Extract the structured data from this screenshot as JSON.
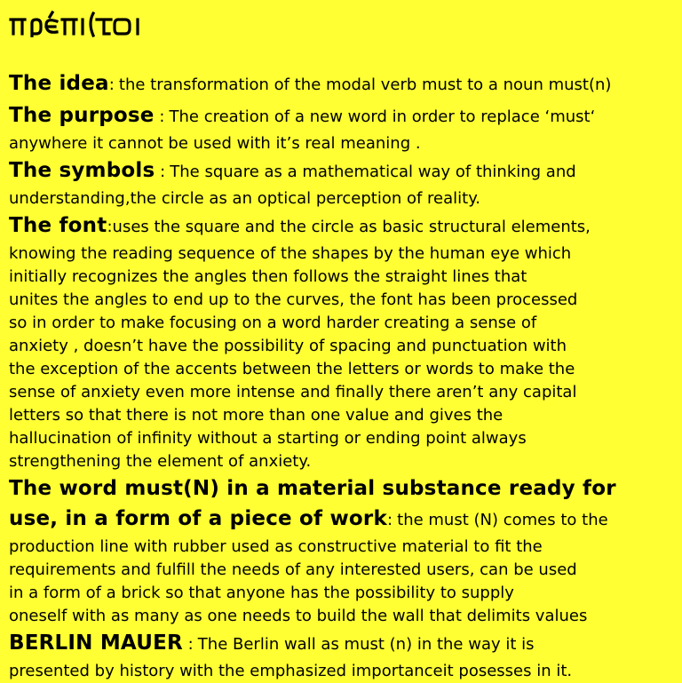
{
  "logo": {
    "text": "πρέπι(τoι",
    "icon_name": "custom-font-logo"
  },
  "sections": [
    {
      "heading": "The idea",
      "separator": ":",
      "intro": "the transformation of the modal verb must to a noun must(n)",
      "lines": []
    },
    {
      "heading": "The purpose",
      "separator": " :",
      "intro": "The creation of a new word in order to replace ‘must‘",
      "lines": [
        "anywhere it cannot be used with it’s real meaning ."
      ]
    },
    {
      "heading": "The symbols",
      "separator": " :",
      "intro": "The square as a mathematical way of thinking and",
      "lines": [
        "understanding,the circle as an optical perception of reality."
      ]
    },
    {
      "heading": "The font",
      "separator": ":",
      "intro": "uses the square and the circle as basic structural elements,",
      "lines": [
        "knowing the reading sequence of the shapes by the human eye which",
        "initially recognizes the angles then follows the straight lines that",
        "unites the angles to end up to the curves, the font has been processed",
        "so in order to make focusing on a word harder creating a sense of",
        "anxiety , doesn’t have the possibility of spacing and punctuation with",
        "the exception of the accents between the letters or words to make the",
        "sense of anxiety even more intense and finally there aren’t any capital",
        "letters so that there is not more than one value and gives the",
        "hallucination of infinity without a starting or ending point always",
        "strengthening the element of anxiety."
      ]
    },
    {
      "heading_line1": "The word must(N) in a material substance ready for",
      "heading": "use, in a form of a piece of work",
      "separator": ":",
      "intro": "the must (N) comes to the",
      "lines": [
        "production line with rubber used as constructive material to fit the",
        "requirements and fulfill the needs of any interested users, can be used",
        "in a form of a brick so that anyone has the possibility to supply",
        "oneself with as many as one needs to build the wall that delimits values"
      ]
    },
    {
      "heading": "BERLIN MAUER",
      "separator": " :",
      "intro": "The Berlin wall as must (n) in the way it is",
      "lines": [
        "presented by history with the emphasized importanceit posesses in it."
      ]
    }
  ],
  "colors": {
    "background": "#ffff33",
    "text": "#000000"
  }
}
